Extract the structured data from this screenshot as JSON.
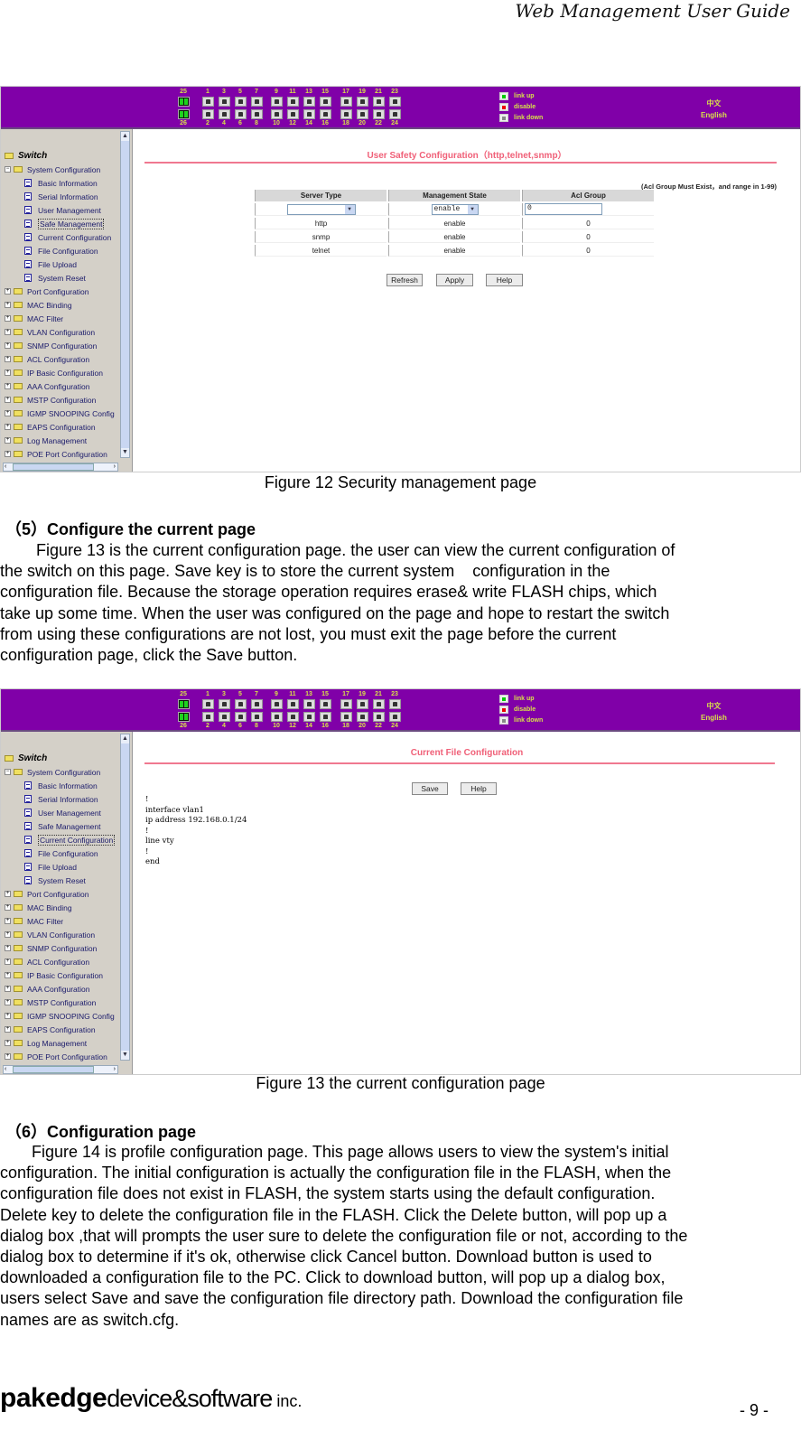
{
  "header": {
    "title": "Web Management User Guide"
  },
  "switch_ui": {
    "ports_top": [
      "25",
      "1",
      "3",
      "5",
      "7",
      "9",
      "11",
      "13",
      "15",
      "17",
      "19",
      "21",
      "23"
    ],
    "ports_bottom": [
      "26",
      "2",
      "4",
      "6",
      "8",
      "10",
      "12",
      "14",
      "16",
      "18",
      "20",
      "22",
      "24"
    ],
    "legend": {
      "link_up": "link up",
      "disable": "disable",
      "link_down": "link down"
    },
    "lang": {
      "chinese": "中文",
      "english": "English"
    },
    "colors": {
      "topbar": "#8000a8",
      "label": "#d8e04a",
      "title": "#f06078"
    },
    "tree": {
      "root": "Switch",
      "system_config": "System Configuration",
      "children": [
        "Basic Information",
        "Serial Information",
        "User Management",
        "Safe Management",
        "Current Configuration",
        "File Configuration",
        "File Upload",
        "System Reset"
      ],
      "folders": [
        "Port Configuration",
        "MAC Binding",
        "MAC Filter",
        "VLAN Configuration",
        "SNMP Configuration",
        "ACL Configuration",
        "IP Basic Configuration",
        "AAA Configuration",
        "MSTP Configuration",
        "IGMP SNOOPING Config",
        "EAPS Configuration",
        "Log Management",
        "POE Port Configuration"
      ]
    }
  },
  "figure12": {
    "title": "User Safety Configuration（http,telnet,snmp）",
    "note": "(Acl Group Must Exist，and range in 1-99)",
    "columns": [
      "Server Type",
      "Management State",
      "Acl Group"
    ],
    "input_row": {
      "server_type": "",
      "management_state": "enable",
      "acl_group": "0"
    },
    "rows": [
      {
        "server": "http",
        "state": "enable",
        "acl": "0"
      },
      {
        "server": "snmp",
        "state": "enable",
        "acl": "0"
      },
      {
        "server": "telnet",
        "state": "enable",
        "acl": "0"
      }
    ],
    "buttons": {
      "refresh": "Refresh",
      "apply": "Apply",
      "help": "Help"
    },
    "selected_item": "Safe Management",
    "caption": "Figure 12 Security management page"
  },
  "section5": {
    "heading": "（5）Configure the current page",
    "lines": [
      "        Figure 13 is the current configuration page. the user can view the current configuration of",
      "the switch on this page. Save key is to store the current system    configuration in the",
      "configuration file. Because the storage operation requires erase& write FLASH chips, which",
      "take up some time. When the user was configured on the page and hope to restart the switch",
      "from using these configurations are not lost, you must exit the page before the current",
      "configuration page, click the Save button."
    ]
  },
  "figure13": {
    "title": "Current File Configuration",
    "buttons": {
      "save": "Save",
      "help": "Help"
    },
    "config_text": "!\ninterface vlan1\nip address 192.168.0.1/24\n!\nline vty\n!\nend",
    "selected_item": "Current Configuration",
    "caption": "Figure 13 the current configuration page"
  },
  "section6": {
    "heading": "（6）Configuration page",
    "lines": [
      "       Figure 14 is profile configuration page. This page allows users to view the system's initial",
      "configuration. The initial configuration is actually the configuration file in the FLASH, when the",
      "configuration file does not exist in FLASH, the system starts using the default configuration.",
      "Delete key to delete the configuration file in the FLASH. Click the Delete button, will pop up a",
      "dialog box ,that will prompts the user sure to delete the configuration file or not, according to the",
      "dialog box to determine if it's ok, otherwise click Cancel button. Download button is used to",
      "downloaded a configuration file to the PC. Click to download button, will pop up a dialog box,",
      "users select Save and save the configuration file directory path. Download the configuration file",
      "names are as switch.cfg."
    ]
  },
  "footer": {
    "brand": "pakedge",
    "rest": "device&software",
    "inc": " inc.",
    "page": "- 9 -"
  }
}
